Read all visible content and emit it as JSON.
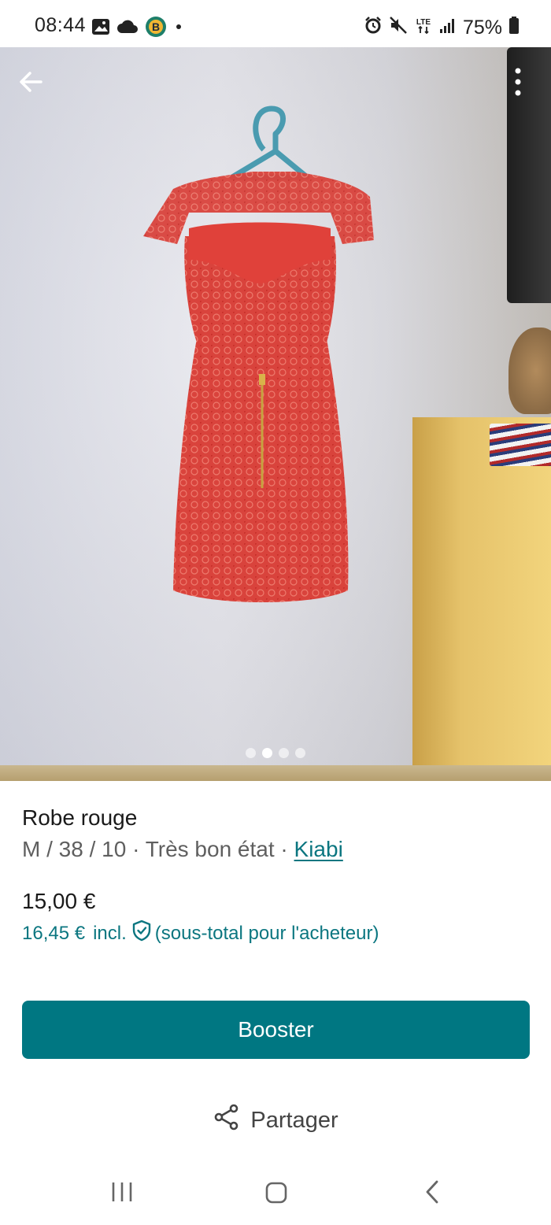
{
  "status_bar": {
    "time": "08:44",
    "battery": "75%",
    "network": "LTE",
    "left_icons": [
      "image-icon",
      "cloud-icon",
      "b-app-icon",
      "dot-icon"
    ],
    "right_icons": [
      "alarm-icon",
      "mute-icon",
      "lte-icon",
      "signal-icon",
      "battery-icon"
    ]
  },
  "photo": {
    "carousel": {
      "total": 4,
      "active_index": 1
    },
    "back_icon": "arrow-left-icon",
    "more_icon": "more-vertical-icon"
  },
  "item": {
    "title": "Robe rouge",
    "size": "M / 38 / 10",
    "separator": " · ",
    "condition": "Très bon état",
    "brand": "Kiabi",
    "price": "15,00 €",
    "total_price": "16,45 €",
    "total_incl": "incl.",
    "total_note": "(sous-total pour l'acheteur)"
  },
  "actions": {
    "booster_label": "Booster",
    "share_label": "Partager",
    "share_icon": "share-icon"
  },
  "nav": {
    "icons": [
      "recents-icon",
      "home-icon",
      "back-icon"
    ]
  },
  "colors": {
    "accent": "#007782",
    "link": "#0b7680",
    "dress": "#d63a35"
  }
}
